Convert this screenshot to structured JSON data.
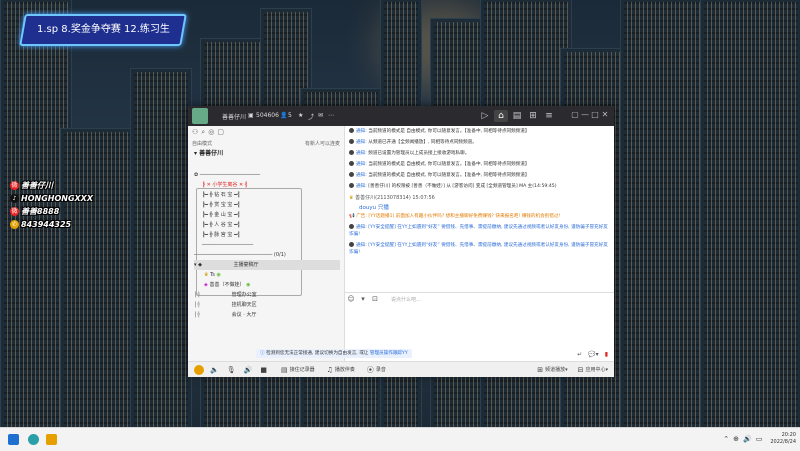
{
  "desktop": {
    "banner": "1.sp 8.奖金争夺赛 12.练习生",
    "socials": [
      {
        "icon": "weibo-icon",
        "text": "善善仔川"
      },
      {
        "icon": "douyin-icon",
        "text": "HONGHONGXXX"
      },
      {
        "icon": "weibo-icon",
        "text": "善善8888"
      },
      {
        "icon": "phone-icon",
        "text": "843944325"
      }
    ]
  },
  "app": {
    "title_name": "善善仔川",
    "room_id": "504606",
    "member_count": "5",
    "nav_icons": [
      "video-icon",
      "home-icon",
      "list-icon",
      "game-icon",
      "menu-icon"
    ],
    "mode_label": "自由模式",
    "mode_right": "有新人可以连麦",
    "room_name": "善善仔川",
    "tree": {
      "banner_row": "╠ ✕ 小学生离谷 ✕ ╣",
      "rows": [
        "╠━ ╬  钻  石  宝 ━╣",
        "╠━ ╬  赏  宝  宝 ━╣",
        "╠━ ╬  金  山  宝 ━╣",
        "╠━ ╬  人  谷  宝 ━╣",
        "╠━ ╬  脉  宫  宝 ━╣"
      ],
      "counter": "(0/1)",
      "selected": "主播宴稿厅",
      "sub1": "Ts",
      "sub2": "善善（不做娃）",
      "channels": [
        "管理办公室",
        "挂机聊天区",
        "会议 · 大厅"
      ]
    },
    "messages": [
      {
        "prefix": "通知:",
        "text": "当前频道的模式是 自由模式, 你可以随意发言。【准备中, 同相等待点同频频道】"
      },
      {
        "prefix": "通知:",
        "text": "从频道已开通【全频闻播放】, 同相等待点同频频道。"
      },
      {
        "prefix": "通知:",
        "text": "频道已设置为管理员以上成员接上接收游戏私聊。"
      },
      {
        "prefix": "通知:",
        "text": "当前频道的模式是 自由模式, 你可以随意发言。【准备中, 同相等待点同频频道】"
      },
      {
        "prefix": "通知:",
        "text": "当前频道的模式是 自由模式, 你可以随意发言。【准备中, 同相等待点同频频道】"
      },
      {
        "prefix": "通知:",
        "text": "[善善仔川] 的权限被 [善善（不做娃）] 从 [游客访问] 变成 [全频道管理员] MA 主(14:59:45)"
      }
    ],
    "user_post": {
      "name": "善善仔川(2113078314)  15:07:56",
      "text": "douyu 只播"
    },
    "ad_message": "广告: [YY话题播1] 前面加入有趣小伙伴吗? 想和主播聊好免费赚钱? 快来报名吧! 赚钱的机会别错过!",
    "security": [
      "通知: [YY安全提醒] 在YY上如遇到“好友” 要借钱、先借事、需提前缴纳, 建议先通过视频或者认好友身份, 谨防骗子冒充好友诈骗!",
      "通知: [YY安全提醒] 在YY上如遇到“好友” 要借钱、先借事、需提前缴纳, 建议先通过视频或者认好友身份, 谨防骗子冒充好友诈骗!"
    ],
    "input_placeholder": "说点什么吧...",
    "notice": {
      "text": "检测到您无法正常接通, 建议切换为自由发言, 或让",
      "link": "管理员操作跟踪YY"
    },
    "bottom": {
      "mic_value": "",
      "items": [
        {
          "icon": "music-icon",
          "label": "接住记录器"
        },
        {
          "icon": "note-icon",
          "label": "播放伴奏"
        },
        {
          "icon": "record-icon",
          "label": "录音"
        }
      ],
      "voice_label": "频道播放",
      "settings_label": "应用中心"
    }
  },
  "taskbar": {
    "time": "20:20",
    "date": "2022/8/24"
  }
}
